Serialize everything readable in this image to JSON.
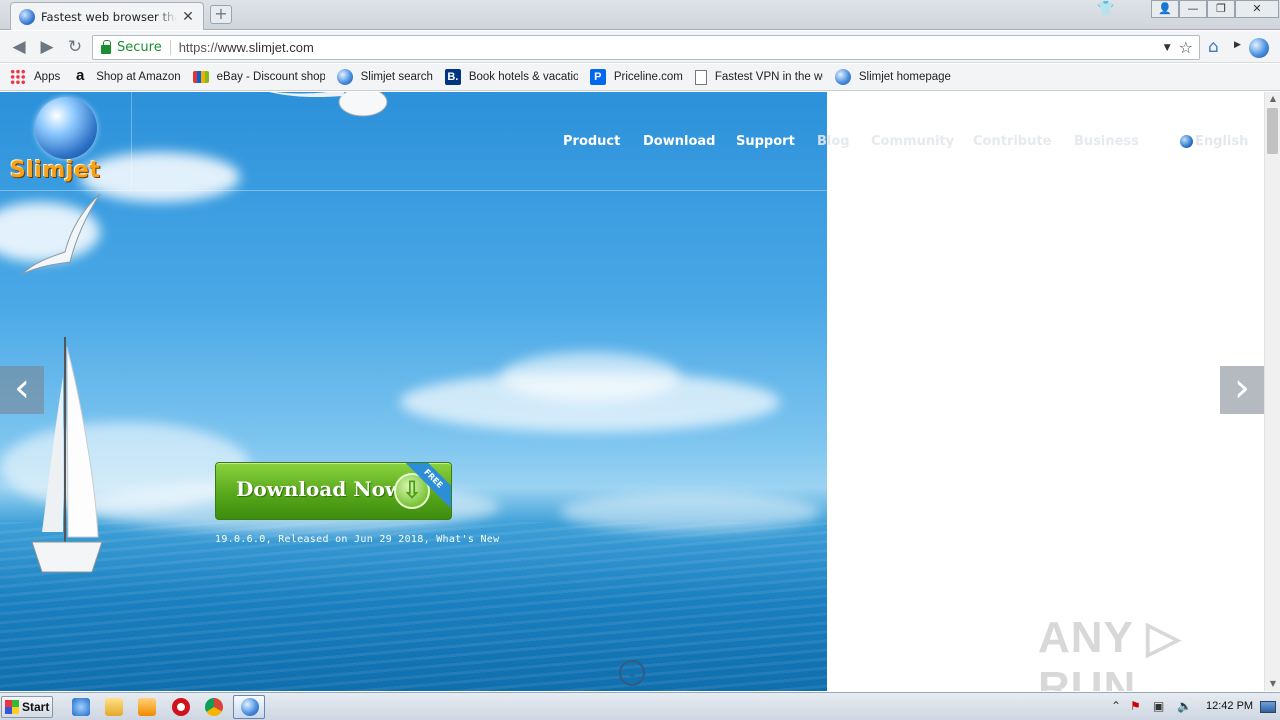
{
  "browser": {
    "tab": {
      "title": "Fastest web browser that blocks ads",
      "close": "✕"
    },
    "new_tab": "+",
    "window_controls": [
      "👤",
      "—",
      "❐",
      "✕"
    ],
    "toolbar": {
      "back": "◀",
      "forward": "▶",
      "reload": "↻",
      "secure_label": "Secure",
      "url_scheme": "https://",
      "url_host": "www.slimjet.com",
      "dropdown": "▼",
      "star": "☆",
      "home": "⌂",
      "home_dropdown": "▶"
    },
    "bookmarks": [
      {
        "icon": "apps-icon",
        "label": "Apps"
      },
      {
        "icon": "amazon-icon",
        "glyph": "a",
        "label": "Shop at Amazon"
      },
      {
        "icon": "ebay-icon",
        "label": "eBay - Discount shoppi"
      },
      {
        "icon": "globe-icon",
        "label": "Slimjet search"
      },
      {
        "icon": "booking-icon",
        "glyph": "B.",
        "label": "Book hotels & vacation"
      },
      {
        "icon": "priceline-icon",
        "glyph": "P",
        "label": "Priceline.com"
      },
      {
        "icon": "page-icon",
        "label": "Fastest VPN in the wor"
      },
      {
        "icon": "globe-icon",
        "label": "Slimjet homepage"
      }
    ]
  },
  "site": {
    "logo_text": "Slimjet",
    "nav": [
      {
        "label": "Product"
      },
      {
        "label": "Download"
      },
      {
        "label": "Support"
      },
      {
        "label": "Blog"
      },
      {
        "label": "Community"
      },
      {
        "label": "Contribute"
      },
      {
        "label": "Business"
      }
    ],
    "language": "English",
    "slider": {
      "prev": "‹",
      "next": "›"
    },
    "download_button": {
      "label": "Download Now",
      "badge": "FREE",
      "arrow": "⇩"
    },
    "release_info": "19.0.6.0, Released on Jun 29 2018, What's New",
    "scroll_hint": "⌄"
  },
  "scrollbar": {
    "up": "▲",
    "down": "▼"
  },
  "watermark": "ANY ▷ RUN",
  "taskbar": {
    "start_label": "Start",
    "clock": "12:42 PM"
  }
}
